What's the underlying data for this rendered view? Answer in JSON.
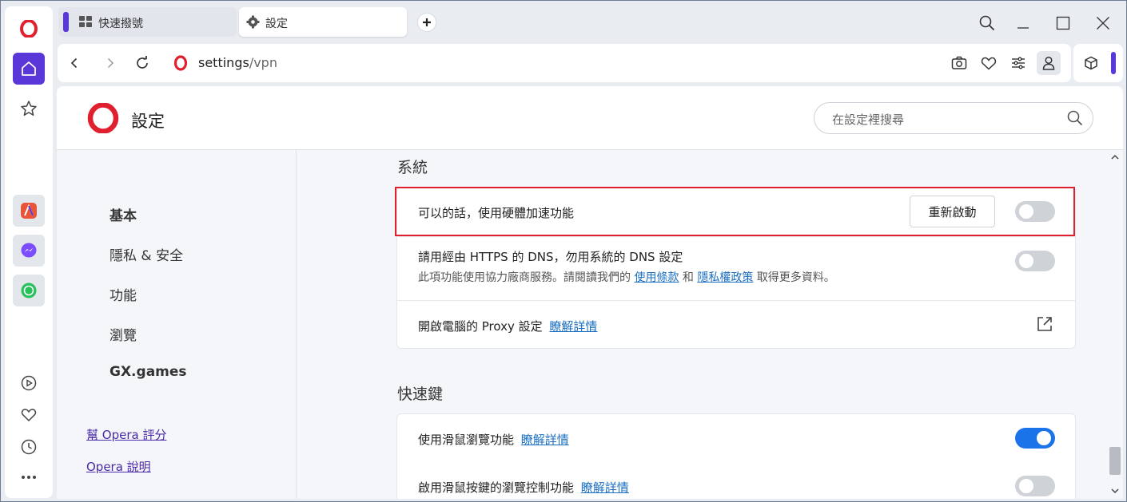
{
  "tabs": [
    {
      "label": "快速撥號",
      "icon": "speed-dial-icon",
      "active": false
    },
    {
      "label": "設定",
      "icon": "gear-icon",
      "active": true
    }
  ],
  "address": {
    "host": "settings",
    "path": "/vpn"
  },
  "settings": {
    "title": "設定",
    "search_placeholder": "在設定裡搜尋"
  },
  "nav": {
    "items": [
      {
        "label": "基本",
        "bold": true
      },
      {
        "label": "隱私 & 安全",
        "bold": false
      },
      {
        "label": "功能",
        "bold": false
      },
      {
        "label": "瀏覽",
        "bold": false
      },
      {
        "label": "GX.games",
        "bold": true
      }
    ],
    "links": [
      "幫 Opera 評分",
      "Opera 說明"
    ]
  },
  "system": {
    "heading": "系統",
    "hw_accel": {
      "label": "可以的話，使用硬體加速功能",
      "button": "重新啟動",
      "enabled": false
    },
    "dns": {
      "label": "請用經由 HTTPS 的 DNS，勿用系統的 DNS 設定",
      "sub_prefix": "此項功能使用協力廠商服務。請閱讀我們的",
      "terms_link": "使用條款",
      "and": "和",
      "privacy_link": "隱私權政策",
      "sub_suffix": "取得更多資料。",
      "enabled": false
    },
    "proxy": {
      "label": "開啟電腦的 Proxy 設定",
      "link": "瞭解詳情"
    }
  },
  "shortcuts": {
    "heading": "快速鍵",
    "mouse_gestures": {
      "label": "使用滑鼠瀏覽功能",
      "link": "瞭解詳情",
      "enabled": true
    },
    "rocker_gestures": {
      "label": "啟用滑鼠按鍵的瀏覽控制功能",
      "link": "瞭解詳情",
      "enabled": false
    }
  },
  "colors": {
    "accent": "#5a37d9",
    "toggle_on": "#1a73e8",
    "highlight": "#e0202e",
    "opera_red": "#e0202e"
  }
}
